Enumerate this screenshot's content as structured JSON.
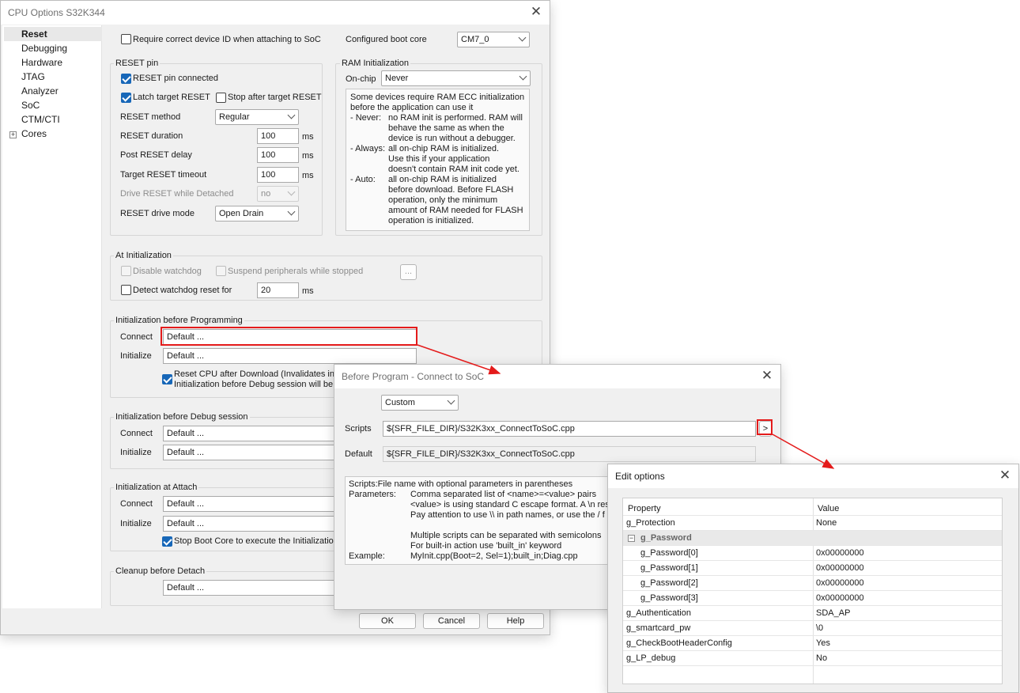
{
  "main": {
    "title": "CPU Options S32K344",
    "nav": [
      "Reset",
      "Debugging",
      "Hardware",
      "JTAG",
      "Analyzer",
      "SoC",
      "CTM/CTI",
      "Cores"
    ],
    "require_id_label": "Require correct device ID when attaching to SoC",
    "boot_core_label": "Configured boot core",
    "boot_core_value": "CM7_0",
    "reset_pin": {
      "title": "RESET pin",
      "connected": "RESET pin connected",
      "latch": "Latch target RESET",
      "stop_after": "Stop after target RESET",
      "method_label": "RESET method",
      "method_value": "Regular",
      "duration_label": "RESET duration",
      "duration_value": "100",
      "post_delay_label": "Post RESET delay",
      "post_delay_value": "100",
      "timeout_label": "Target RESET timeout",
      "timeout_value": "100",
      "ms": "ms",
      "drive_detached_label": "Drive RESET while Detached",
      "drive_detached_value": "no",
      "drive_mode_label": "RESET drive mode",
      "drive_mode_value": "Open Drain"
    },
    "ram_init": {
      "title": "RAM Initialization",
      "onchip_label": "On-chip",
      "onchip_value": "Never",
      "help": [
        "Some devices require RAM ECC initialization",
        "before the application can use it",
        "- Never:",
        "no RAM init is performed. RAM will",
        "behave the same as when the",
        "device is run without a debugger.",
        "- Always:",
        "all on-chip RAM is initialized.",
        "Use this if your application",
        "doesn't contain RAM init code yet.",
        "- Auto:",
        "all on-chip RAM is initialized",
        "before download. Before FLASH",
        "operation, only the minimum",
        "amount of RAM needed for FLASH",
        "operation is initialized."
      ]
    },
    "at_init": {
      "title": "At Initialization",
      "disable_wd": "Disable watchdog",
      "suspend": "Suspend peripherals while stopped",
      "ellipsis": "...",
      "detect_wd": "Detect watchdog reset for",
      "detect_wd_value": "20",
      "ms": "ms"
    },
    "init_prog": {
      "title": "Initialization before Programming",
      "connect_label": "Connect",
      "connect_value": "Default ...",
      "initialize_label": "Initialize",
      "initialize_value": "Default ...",
      "reset_cpu_line1": "Reset CPU after Download (Invalidates ini",
      "reset_cpu_line2": "Initialization before Debug session will be p"
    },
    "init_debug": {
      "title": "Initialization before Debug session",
      "connect_label": "Connect",
      "connect_value": "Default ...",
      "initialize_label": "Initialize",
      "initialize_value": "Default ..."
    },
    "init_attach": {
      "title": "Initialization at Attach",
      "connect_label": "Connect",
      "connect_value": "Default ...",
      "initialize_label": "Initialize",
      "initialize_value": "Default ...",
      "stop_boot": "Stop Boot Core to execute the Initialization"
    },
    "cleanup": {
      "title": "Cleanup before Detach",
      "value": "Default ..."
    },
    "ok": "OK",
    "cancel": "Cancel",
    "help": "Help"
  },
  "before_program": {
    "title": "Before Program - Connect to SoC",
    "mode_value": "Custom",
    "scripts_label": "Scripts",
    "scripts_value": "${SFR_FILE_DIR}/S32K3xx_ConnectToSoC.cpp",
    "arrow_button": ">",
    "default_label": "Default",
    "default_value": "${SFR_FILE_DIR}/S32K3xx_ConnectToSoC.cpp",
    "help": {
      "line1": "Scripts:File name with optional parameters in parentheses",
      "params_label": "Parameters:",
      "p1": "Comma separated list of <name>=<value> pairs",
      "p2": "<value> is using standard C escape format. A \\n res",
      "p3": "Pay attention to use \\\\ in path names, or use the / f",
      "p4": "Multiple scripts can be separated with semicolons",
      "p5": "For built-in action use 'built_in' keyword",
      "example_label": "Example:",
      "example": "MyInit.cpp(Boot=2, Sel=1);built_in;Diag.cpp"
    }
  },
  "edit_options": {
    "title": "Edit options",
    "header_property": "Property",
    "header_value": "Value",
    "rows": [
      {
        "name": "g_Protection",
        "value": "None"
      },
      {
        "name": "g_Password",
        "value": ""
      },
      {
        "name": "g_Password[0]",
        "value": "0x00000000"
      },
      {
        "name": "g_Password[1]",
        "value": "0x00000000"
      },
      {
        "name": "g_Password[2]",
        "value": "0x00000000"
      },
      {
        "name": "g_Password[3]",
        "value": "0x00000000"
      },
      {
        "name": "g_Authentication",
        "value": "SDA_AP"
      },
      {
        "name": "g_smartcard_pw",
        "value": "\\0"
      },
      {
        "name": "g_CheckBootHeaderConfig",
        "value": "Yes"
      },
      {
        "name": "g_LP_debug",
        "value": "No"
      }
    ]
  },
  "colors": {
    "annotation": "#e41b1b",
    "check": "#1767b8"
  }
}
